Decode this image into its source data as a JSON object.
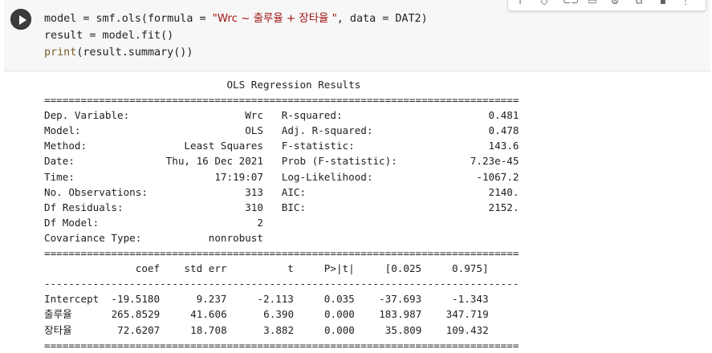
{
  "code": {
    "line1_a": "model = smf.ols(formula = ",
    "line1_str": "\"Wrc ~ 출루율 + 장타율 \"",
    "line1_b": ", data = DAT2)",
    "line2": "result = model.fit()",
    "line3_fn": "print",
    "line3_rest": "(result.summary())"
  },
  "toolbar_icons": [
    "up-arrow-icon",
    "down-arrow-icon",
    "link-icon",
    "comment-icon",
    "gear-icon",
    "mirror-icon",
    "trash-icon",
    "more-icon"
  ],
  "summary": {
    "title": "OLS Regression Results",
    "rule_eq": "==============================================================================",
    "rule_dash": "------------------------------------------------------------------------------",
    "stats": [
      {
        "l_label": "Dep. Variable:",
        "l_value": "Wrc",
        "r_label": "R-squared:",
        "r_value": "0.481"
      },
      {
        "l_label": "Model:",
        "l_value": "OLS",
        "r_label": "Adj. R-squared:",
        "r_value": "0.478"
      },
      {
        "l_label": "Method:",
        "l_value": "Least Squares",
        "r_label": "F-statistic:",
        "r_value": "143.6"
      },
      {
        "l_label": "Date:",
        "l_value": "Thu, 16 Dec 2021",
        "r_label": "Prob (F-statistic):",
        "r_value": "7.23e-45"
      },
      {
        "l_label": "Time:",
        "l_value": "17:19:07",
        "r_label": "Log-Likelihood:",
        "r_value": "-1067.2"
      },
      {
        "l_label": "No. Observations:",
        "l_value": "313",
        "r_label": "AIC:",
        "r_value": "2140."
      },
      {
        "l_label": "Df Residuals:",
        "l_value": "310",
        "r_label": "BIC:",
        "r_value": "2152."
      },
      {
        "l_label": "Df Model:",
        "l_value": "2",
        "r_label": "",
        "r_value": ""
      },
      {
        "l_label": "Covariance Type:",
        "l_value": "nonrobust",
        "r_label": "",
        "r_value": ""
      }
    ],
    "coef_header": [
      "coef",
      "std err",
      "t",
      "P>|t|",
      "[0.025",
      "0.975]"
    ],
    "coef_rows": [
      {
        "name": "Intercept",
        "values": [
          "-19.5180",
          "9.237",
          "-2.113",
          "0.035",
          "-37.693",
          "-1.343"
        ]
      },
      {
        "name": "출루율",
        "values": [
          "265.8529",
          "41.606",
          "6.390",
          "0.000",
          "183.987",
          "347.719"
        ]
      },
      {
        "name": "장타율",
        "values": [
          "72.6207",
          "18.708",
          "3.882",
          "0.000",
          "35.809",
          "109.432"
        ]
      }
    ]
  }
}
